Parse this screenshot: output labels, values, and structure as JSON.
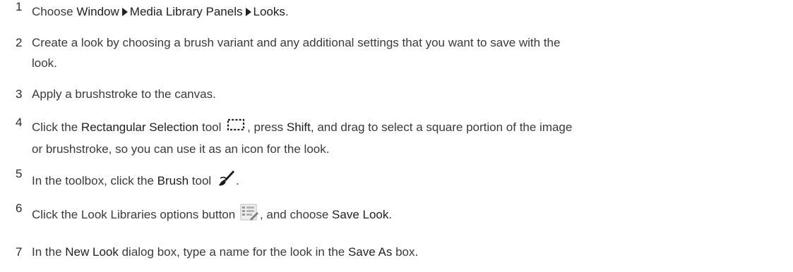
{
  "steps": [
    {
      "num": "1",
      "parts": {
        "pre": "Choose ",
        "menu1": "Window",
        "menu2": "Media Library Panels",
        "menu3": "Looks",
        "end": "."
      }
    },
    {
      "num": "2",
      "line1": "Create a look by choosing a brush variant and any additional settings that you want to save with the",
      "line2": "look."
    },
    {
      "num": "3",
      "text": "Apply a brushstroke to the canvas."
    },
    {
      "num": "4",
      "parts": {
        "pre": "Click the ",
        "tool": "Rectangular Selection",
        "mid": " tool ",
        "mid2": ", press ",
        "key": "Shift",
        "post": ", and drag to select a square portion of the image",
        "line2": "or brushstroke, so you can use it as an icon for the look."
      },
      "icon": "rectangular-selection-icon"
    },
    {
      "num": "5",
      "parts": {
        "pre": "In the toolbox, click the ",
        "tool": "Brush",
        "post": " tool ",
        "end": "."
      },
      "icon": "brush-tool-icon"
    },
    {
      "num": "6",
      "parts": {
        "pre": "Click the Look Libraries options button ",
        "mid": ", and choose ",
        "cmd": "Save Look",
        "end": "."
      },
      "icon": "library-options-icon"
    },
    {
      "num": "7",
      "parts": {
        "pre": "In the ",
        "dialog": "New Look",
        "mid": " dialog box, type a name for the look in the ",
        "box": "Save As",
        "end": " box."
      }
    }
  ]
}
